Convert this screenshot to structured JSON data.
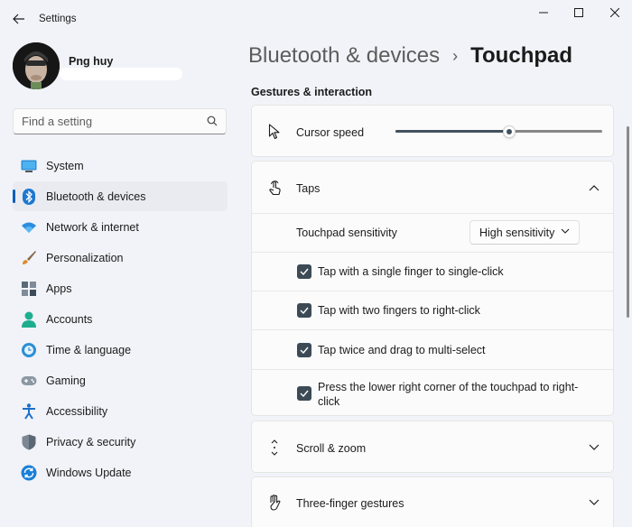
{
  "window": {
    "title": "Settings",
    "controls": [
      "minimize",
      "maximize",
      "close"
    ]
  },
  "profile": {
    "name": "Png huy"
  },
  "search": {
    "placeholder": "Find a setting"
  },
  "nav": {
    "items": [
      {
        "label": "System",
        "icon": "system-icon"
      },
      {
        "label": "Bluetooth & devices",
        "icon": "bluetooth-icon",
        "active": true
      },
      {
        "label": "Network & internet",
        "icon": "wifi-icon"
      },
      {
        "label": "Personalization",
        "icon": "brush-icon"
      },
      {
        "label": "Apps",
        "icon": "apps-icon"
      },
      {
        "label": "Accounts",
        "icon": "account-icon"
      },
      {
        "label": "Time & language",
        "icon": "clock-globe-icon"
      },
      {
        "label": "Gaming",
        "icon": "gamepad-icon"
      },
      {
        "label": "Accessibility",
        "icon": "accessibility-icon"
      },
      {
        "label": "Privacy & security",
        "icon": "shield-icon"
      },
      {
        "label": "Windows Update",
        "icon": "update-icon"
      }
    ]
  },
  "breadcrumb": {
    "parent": "Bluetooth & devices",
    "separator": "›",
    "current": "Touchpad"
  },
  "main": {
    "section_title": "Gestures & interaction",
    "cursor_speed": {
      "label": "Cursor speed",
      "value_fraction": 0.55
    },
    "taps": {
      "label": "Taps",
      "expanded": true,
      "sensitivity": {
        "label": "Touchpad sensitivity",
        "value": "High sensitivity"
      },
      "options": [
        {
          "label": "Tap with a single finger to single-click",
          "checked": true
        },
        {
          "label": "Tap with two fingers to right-click",
          "checked": true
        },
        {
          "label": "Tap twice and drag to multi-select",
          "checked": true
        },
        {
          "label": "Press the lower right corner of the touchpad to right-click",
          "checked": true
        }
      ]
    },
    "scroll_zoom": {
      "label": "Scroll & zoom"
    },
    "three_finger": {
      "label": "Three-finger gestures"
    }
  },
  "colors": {
    "accent": "#005fb8",
    "checkbox": "#3c4a56",
    "slider_fill": "#41515f",
    "background": "#f1f3f8",
    "card": "#fbfbfb"
  }
}
